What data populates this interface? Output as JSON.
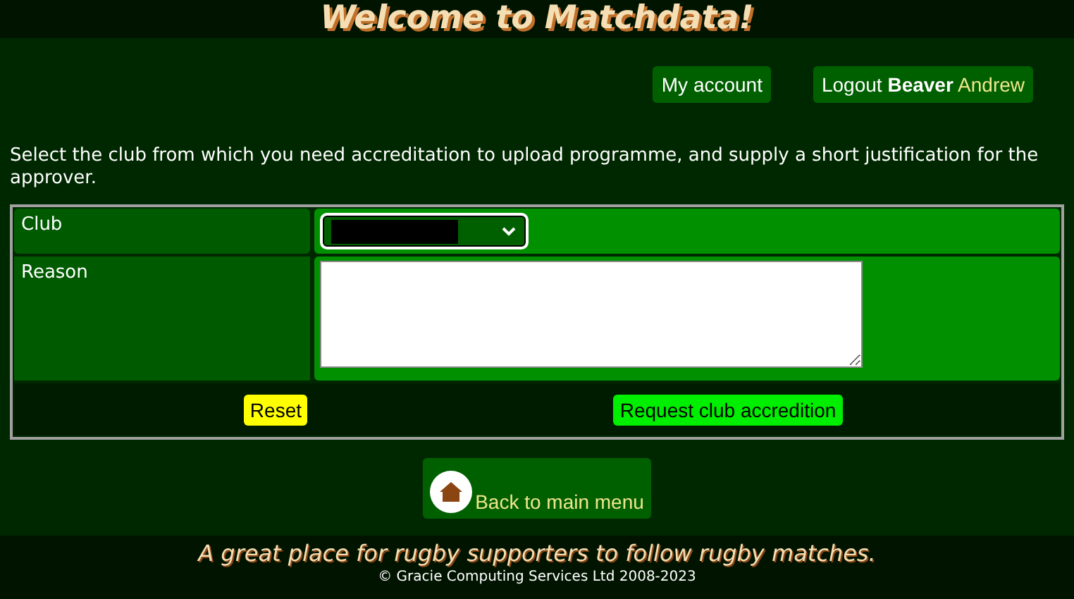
{
  "header": {
    "title": "Welcome to Matchdata!"
  },
  "account_links": [
    {
      "kind": "plain",
      "label": "My account"
    },
    {
      "kind": "user",
      "label": "Logout",
      "surname": "Beaver",
      "forename": "Andrew"
    }
  ],
  "instructions": "Select the club from which you need accreditation to upload programme, and supply a short justification for the approver.",
  "form": {
    "club_label": "Club",
    "reason_label": "Reason",
    "reset_button": "Reset",
    "submit_button": "Request club accredition"
  },
  "back_button": "Back to main menu",
  "footer": {
    "tagline": "A great place for rugby supporters to follow rugby matches.",
    "copyright": "© Gracie Computing Services Ltd 2008-2023"
  }
}
